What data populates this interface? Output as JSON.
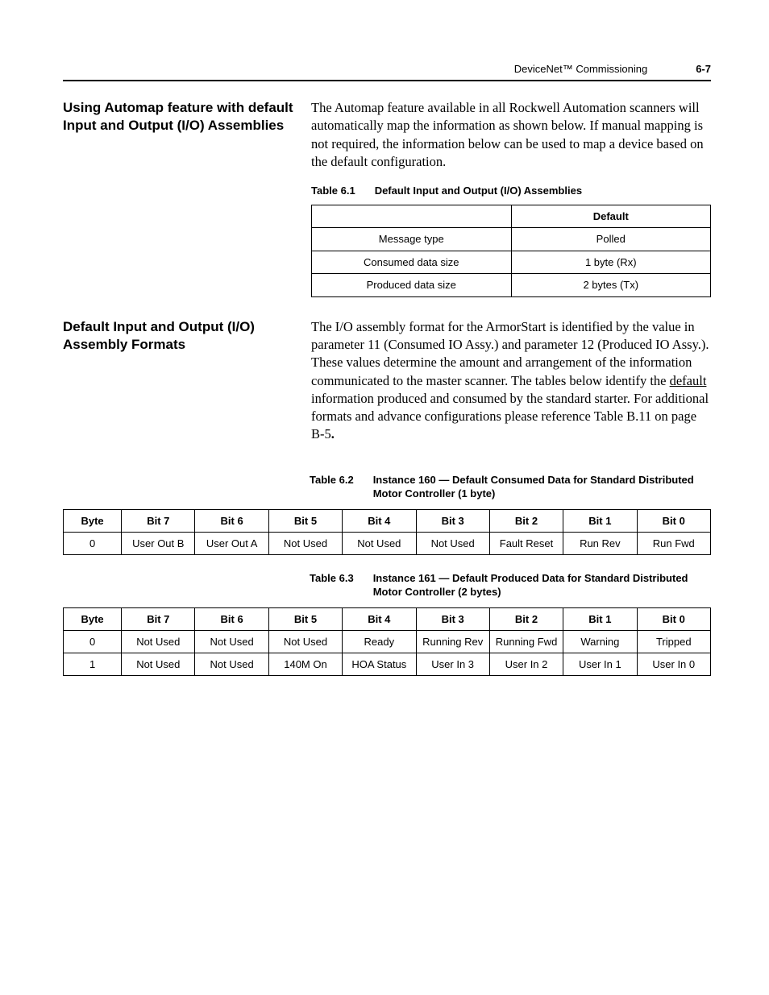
{
  "header": {
    "running_title": "DeviceNet™ Commissioning",
    "page_number": "6-7"
  },
  "section1": {
    "heading": "Using Automap feature with default Input and Output (I/O) Assemblies",
    "paragraph": "The Automap feature available in all Rockwell Automation scanners will automatically map the information as shown below. If manual mapping is not required, the information below can be used to map a device based on the default configuration.",
    "table_caption_num": "Table 6.1",
    "table_caption_text": "Default Input and Output (I/O) Assemblies",
    "table": {
      "head_blank": "",
      "head_default": "Default",
      "rows": [
        {
          "label": "Message type",
          "value": "Polled"
        },
        {
          "label": "Consumed data size",
          "value": "1 byte (Rx)"
        },
        {
          "label": "Produced data size",
          "value": "2 bytes (Tx)"
        }
      ]
    }
  },
  "section2": {
    "heading": "Default Input and Output (I/O) Assembly Formats",
    "para_pre": "The I/O assembly format for the ArmorStart is identified by the value in parameter 11 (Consumed IO Assy.) and parameter 12 (Produced IO Assy.). These values determine the amount and arrangement of the information communicated to the master scanner. The tables below identify the ",
    "para_underline": "default",
    "para_post": " information produced and consumed by the standard starter. For additional formats and advance configurations please reference Table B.11 on page B-5",
    "para_tail": "."
  },
  "table62": {
    "caption_num": "Table 6.2",
    "caption_text": "Instance 160 — Default Consumed Data for Standard Distributed Motor Controller (1 byte)",
    "headers": [
      "Byte",
      "Bit 7",
      "Bit 6",
      "Bit 5",
      "Bit 4",
      "Bit 3",
      "Bit 2",
      "Bit 1",
      "Bit 0"
    ],
    "rows": [
      [
        "0",
        "User Out B",
        "User Out A",
        "Not Used",
        "Not Used",
        "Not Used",
        "Fault Reset",
        "Run Rev",
        "Run Fwd"
      ]
    ]
  },
  "table63": {
    "caption_num": "Table 6.3",
    "caption_text": "Instance 161 — Default Produced Data for Standard Distributed Motor Controller (2 bytes)",
    "headers": [
      "Byte",
      "Bit 7",
      "Bit 6",
      "Bit 5",
      "Bit 4",
      "Bit 3",
      "Bit 2",
      "Bit 1",
      "Bit 0"
    ],
    "rows": [
      [
        "0",
        "Not Used",
        "Not Used",
        "Not Used",
        "Ready",
        "Running Rev",
        "Running Fwd",
        "Warning",
        "Tripped"
      ],
      [
        "1",
        "Not Used",
        "Not Used",
        "140M On",
        "HOA Status",
        "User In 3",
        "User In 2",
        "User In 1",
        "User In 0"
      ]
    ]
  }
}
